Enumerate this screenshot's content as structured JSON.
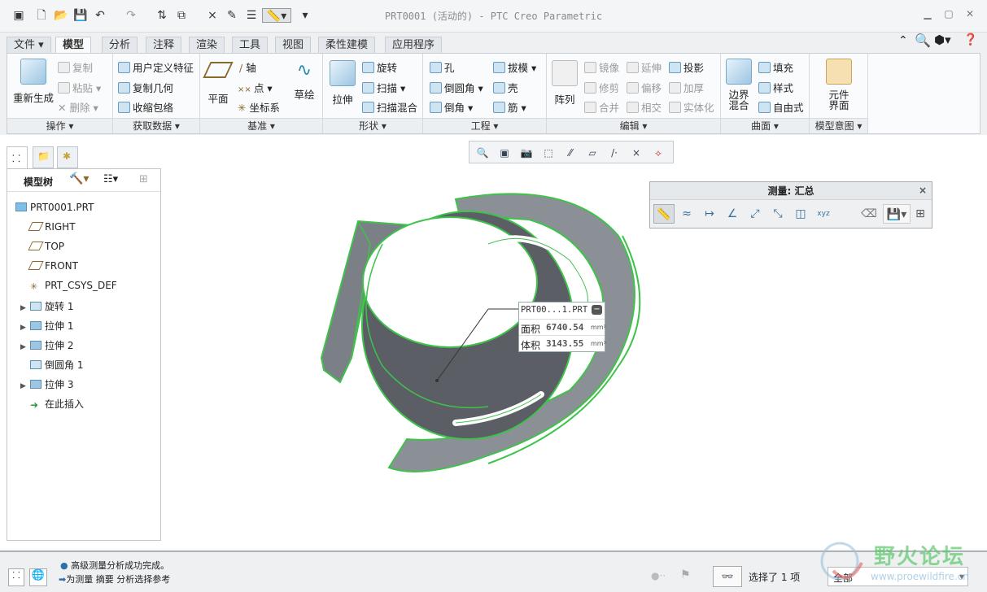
{
  "window": {
    "title": "PRT0001 (活动的) - PTC Creo Parametric"
  },
  "tabs": [
    {
      "label": "文件"
    },
    {
      "label": "模型"
    },
    {
      "label": "分析"
    },
    {
      "label": "注释"
    },
    {
      "label": "渲染"
    },
    {
      "label": "工具"
    },
    {
      "label": "视图"
    },
    {
      "label": "柔性建模"
    },
    {
      "label": "应用程序"
    }
  ],
  "ribbon": {
    "groups": [
      {
        "label": "操作"
      },
      {
        "label": "获取数据"
      },
      {
        "label": "基准"
      },
      {
        "label": "形状"
      },
      {
        "label": "工程"
      },
      {
        "label": "编辑"
      },
      {
        "label": "曲面"
      },
      {
        "label": "模型意图"
      }
    ],
    "ops": {
      "regen": "重新生成",
      "copy": "复制",
      "paste": "粘贴",
      "delete": "删除"
    },
    "data": {
      "udf": "用户定义特征",
      "copygeom": "复制几何",
      "shrinkwrap": "收缩包络"
    },
    "datum": {
      "plane": "平面",
      "axis": "轴",
      "point": "点",
      "csys": "坐标系",
      "sketch": "草绘"
    },
    "shape": {
      "extrude": "拉伸",
      "revolve": "旋转",
      "sweep": "扫描",
      "sweepblend": "扫描混合"
    },
    "eng": {
      "hole": "孔",
      "round": "倒圆角",
      "chamfer": "倒角",
      "draft": "拔模",
      "shell": "壳",
      "rib": "筋"
    },
    "edit": {
      "pattern": "阵列",
      "mirror": "镜像",
      "extend": "延伸",
      "project": "投影",
      "trim": "修剪",
      "offset": "偏移",
      "thicken": "加厚",
      "merge": "合并",
      "intersect": "相交",
      "solidify": "实体化"
    },
    "surface": {
      "boundary1": "边界",
      "boundary2": "混合",
      "fill": "填充",
      "style": "样式",
      "freestyle": "自由式"
    },
    "intent": {
      "comp1": "元件",
      "comp2": "界面"
    }
  },
  "model_tree": {
    "header": "模型树",
    "items": [
      {
        "label": "PRT0001.PRT",
        "icon": "part-icon",
        "expand": false,
        "indent": 0
      },
      {
        "label": "RIGHT",
        "icon": "datum-plane-icon",
        "expand": false,
        "indent": 1
      },
      {
        "label": "TOP",
        "icon": "datum-plane-icon",
        "expand": false,
        "indent": 1
      },
      {
        "label": "FRONT",
        "icon": "datum-plane-icon",
        "expand": false,
        "indent": 1
      },
      {
        "label": "PRT_CSYS_DEF",
        "icon": "csys-icon",
        "expand": false,
        "indent": 1
      },
      {
        "label": "旋转 1",
        "icon": "revolve-icon",
        "expand": true,
        "indent": 1
      },
      {
        "label": "拉伸 1",
        "icon": "extrude-icon",
        "expand": true,
        "indent": 1
      },
      {
        "label": "拉伸 2",
        "icon": "extrude-icon",
        "expand": true,
        "indent": 1
      },
      {
        "label": "倒圆角 1",
        "icon": "round-icon",
        "expand": false,
        "indent": 1
      },
      {
        "label": "拉伸 3",
        "icon": "extrude-icon",
        "expand": true,
        "indent": 1
      },
      {
        "label": "在此插入",
        "icon": "insert-arrow-icon",
        "expand": false,
        "indent": 1
      }
    ]
  },
  "measure": {
    "title": "测量: 汇总",
    "tools": [
      "length-icon",
      "distance-icon",
      "pair-distance-icon",
      "angle-icon",
      "diameter-icon",
      "area-icon",
      "volume-icon",
      "transform-icon"
    ]
  },
  "tooltip": {
    "name": "PRT00...1.PRT",
    "rows": [
      {
        "label": "面积",
        "value": "6740.54",
        "unit": "mm²"
      },
      {
        "label": "体积",
        "value": "3143.55",
        "unit": "mm³"
      }
    ]
  },
  "status": {
    "line1": "高级测量分析成功完成。",
    "line2": "为测量 摘要 分析选择参考",
    "selection": "选择了 1 项",
    "filter": "全部"
  },
  "watermark": {
    "text": "野火论坛",
    "url": "www.proewildfire.cn"
  },
  "colors": {
    "edge_green": "#3fc24a",
    "model_gray": "#55595e",
    "accent": "#2f6fa8"
  }
}
